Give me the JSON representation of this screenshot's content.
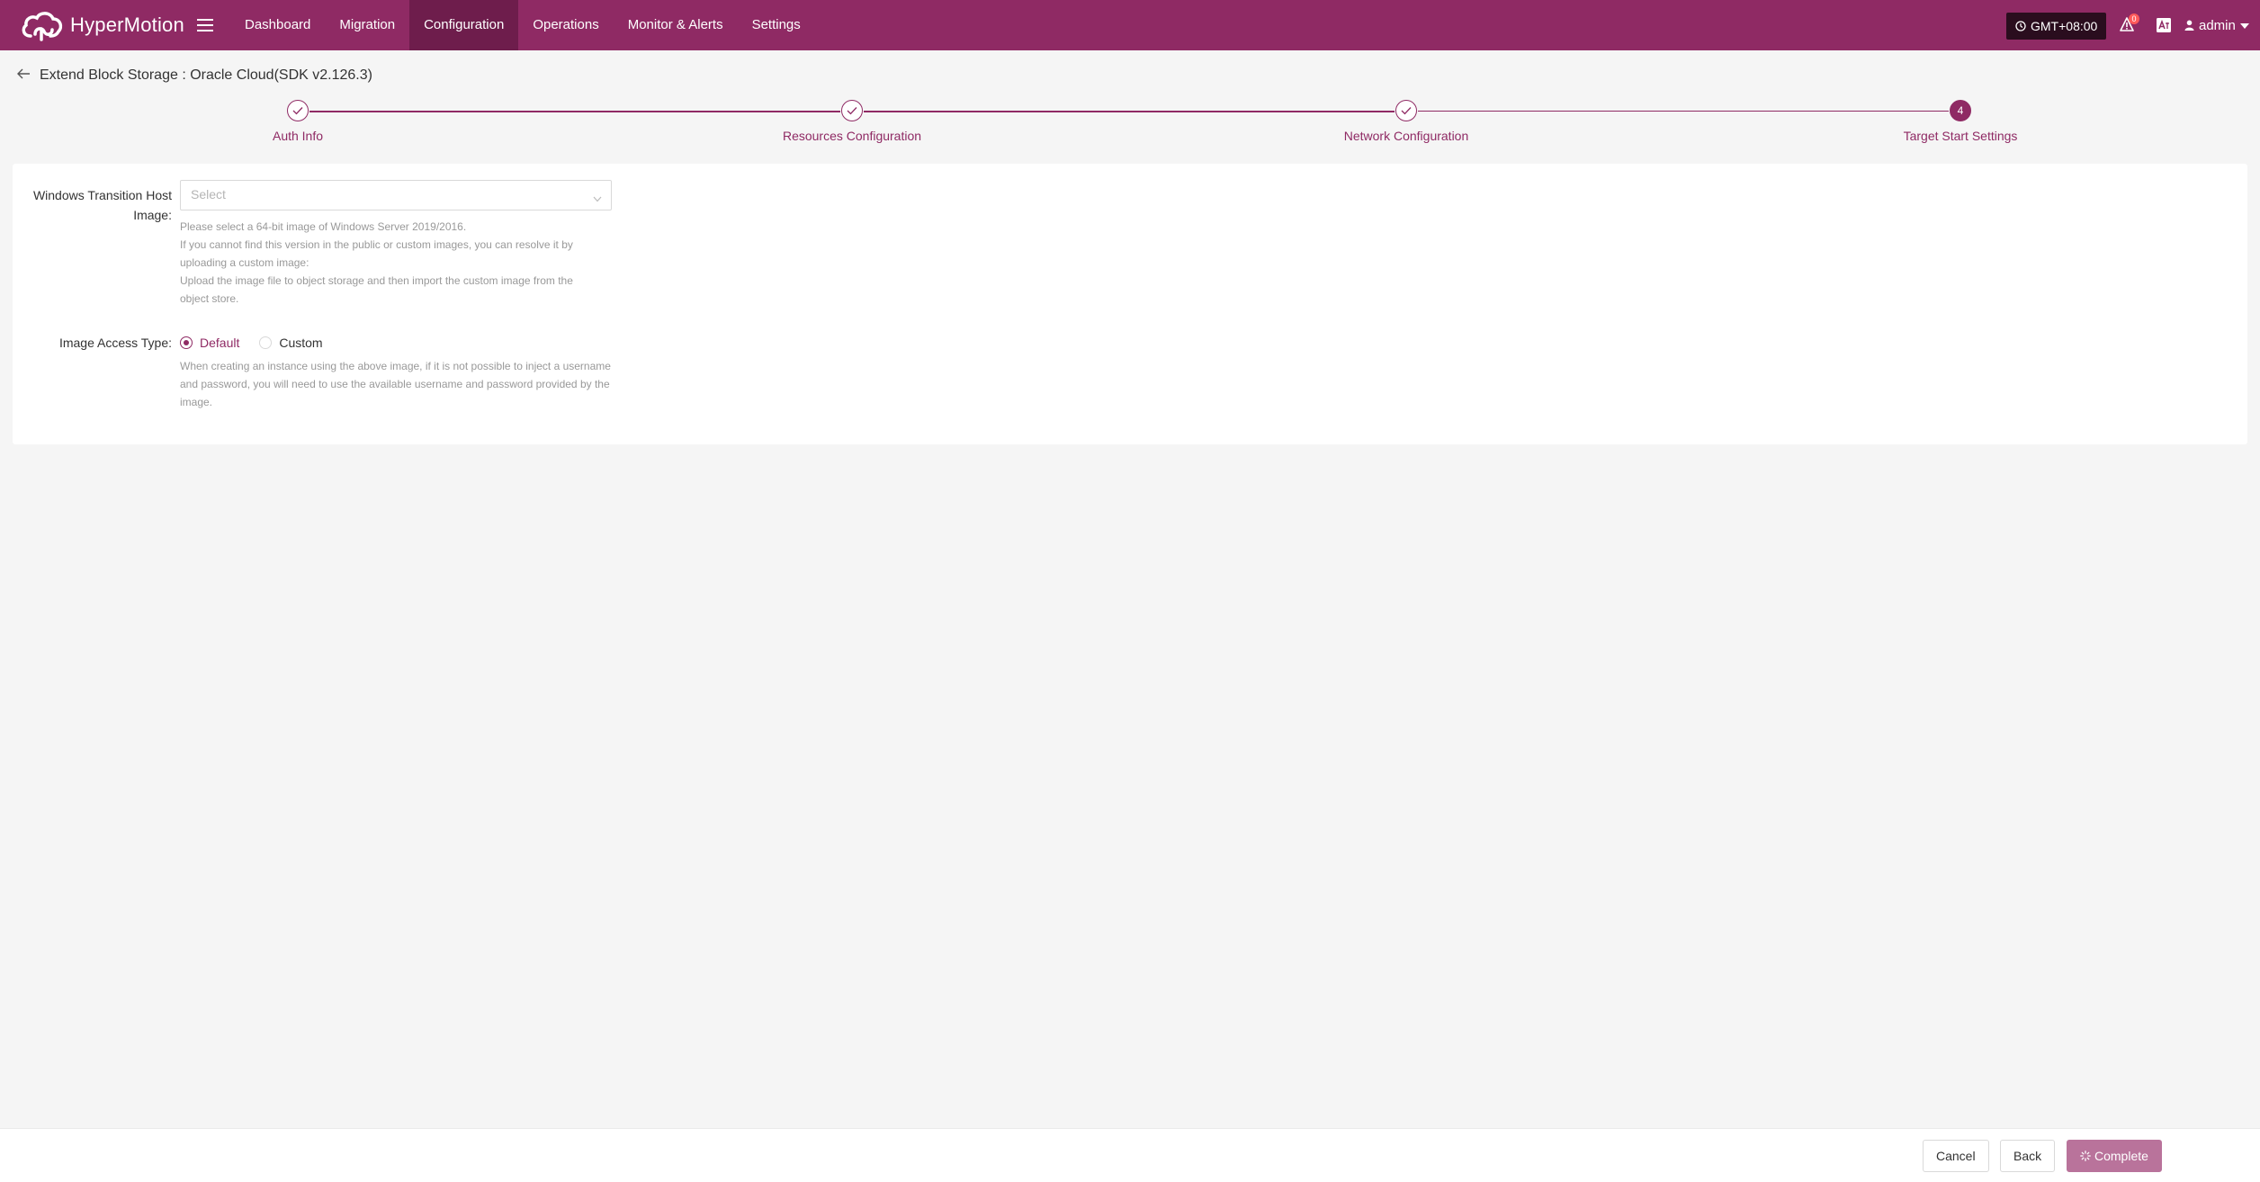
{
  "app": {
    "name": "HyperMotion"
  },
  "nav": {
    "items": [
      {
        "label": "Dashboard",
        "active": false
      },
      {
        "label": "Migration",
        "active": false
      },
      {
        "label": "Configuration",
        "active": true
      },
      {
        "label": "Operations",
        "active": false
      },
      {
        "label": "Monitor & Alerts",
        "active": false
      },
      {
        "label": "Settings",
        "active": false
      }
    ]
  },
  "header": {
    "timezone": "GMT+08:00",
    "notifications": "0",
    "user": "admin"
  },
  "page": {
    "title": "Extend Block Storage : Oracle Cloud(SDK v2.126.3)"
  },
  "steps": [
    {
      "label": "Auth Info",
      "status": "done"
    },
    {
      "label": "Resources Configuration",
      "status": "done"
    },
    {
      "label": "Network Configuration",
      "status": "done"
    },
    {
      "label": "Target Start Settings",
      "status": "current",
      "number": "4"
    }
  ],
  "form": {
    "transition_image": {
      "label_line1": "Windows Transition Host",
      "label_line2": "Image:",
      "placeholder": "Select",
      "help": [
        "Please select a 64-bit image of Windows Server 2019/2016.",
        "If you cannot find this version in the public or custom images, you can resolve it by",
        "uploading a custom image:",
        "Upload the image file to object storage and then import the custom image from the",
        "object store."
      ]
    },
    "image_access": {
      "label": "Image Access Type:",
      "options": [
        {
          "label": "Default",
          "checked": true
        },
        {
          "label": "Custom",
          "checked": false
        }
      ],
      "help": [
        "When creating an instance using the above image, if it is not possible to inject a username",
        "and password, you will need to use the available username and password provided by the",
        "image."
      ]
    }
  },
  "footer": {
    "cancel": "Cancel",
    "back": "Back",
    "complete": "Complete"
  },
  "colors": {
    "brand": "#8f2a64",
    "brand_dark": "#6e1d4c",
    "primary_button_disabled": "#b9739b"
  }
}
